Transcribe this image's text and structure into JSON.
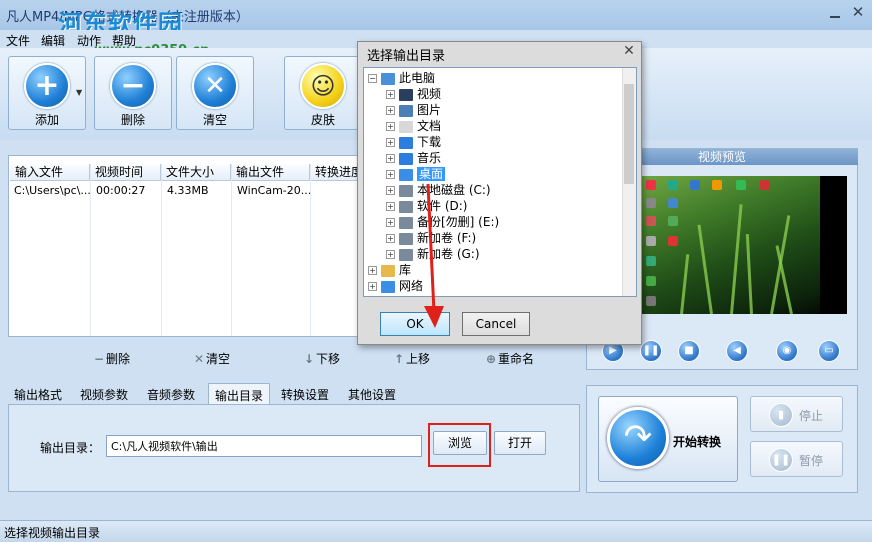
{
  "window": {
    "title": "凡人MP4/MPG格式转换器（未注册版本）",
    "watermark_name": "河东软件园",
    "watermark_url": "www.pc0359.cn"
  },
  "menu": [
    "文件",
    "编辑",
    "动作",
    "帮助"
  ],
  "toolbar": {
    "add": "添加",
    "delete": "删除",
    "clear": "清空",
    "skin": "皮肤"
  },
  "file_table": {
    "headers": [
      "输入文件",
      "视频时间",
      "文件大小",
      "输出文件",
      "转换进度"
    ],
    "rows": [
      [
        "C:\\Users\\pc\\...",
        "00:00:27",
        "4.33MB",
        "WinCam-20...",
        ""
      ]
    ]
  },
  "list_actions": {
    "delete": "删除",
    "clear": "清空",
    "move_down": "下移",
    "move_up": "上移",
    "rename": "重命名"
  },
  "tabs": [
    "输出格式",
    "视频参数",
    "音频参数",
    "输出目录",
    "转换设置",
    "其他设置"
  ],
  "active_tab": "输出目录",
  "output": {
    "label": "输出目录：",
    "path": "C:\\凡人视频软件\\输出",
    "browse": "浏览",
    "open": "打开"
  },
  "preview": {
    "title": "视频预览"
  },
  "convert": {
    "start": "开始转换",
    "stop": "停止",
    "pause": "暂停"
  },
  "status": "选择视频输出目录",
  "dialog": {
    "title": "选择输出目录",
    "tree": [
      {
        "label": "此电脑",
        "level": 0,
        "expander": "−",
        "icon_color": "#4a90d9"
      },
      {
        "label": "视频",
        "level": 1,
        "expander": "+",
        "icon_color": "#2a3f5f"
      },
      {
        "label": "图片",
        "level": 1,
        "expander": "+",
        "icon_color": "#4b7fb5"
      },
      {
        "label": "文档",
        "level": 1,
        "expander": "+",
        "icon_color": "#d8d8d8"
      },
      {
        "label": "下载",
        "level": 1,
        "expander": "+",
        "icon_color": "#2b7de0"
      },
      {
        "label": "音乐",
        "level": 1,
        "expander": "+",
        "icon_color": "#2b7de0"
      },
      {
        "label": "桌面",
        "level": 1,
        "expander": "+",
        "icon_color": "#3a8ee6",
        "selected": true
      },
      {
        "label": "本地磁盘 (C:)",
        "level": 1,
        "expander": "+",
        "icon_color": "#7a8a9a"
      },
      {
        "label": "软件 (D:)",
        "level": 1,
        "expander": "+",
        "icon_color": "#7a8a9a"
      },
      {
        "label": "备份[勿删] (E:)",
        "level": 1,
        "expander": "+",
        "icon_color": "#7a8a9a"
      },
      {
        "label": "新加卷 (F:)",
        "level": 1,
        "expander": "+",
        "icon_color": "#7a8a9a"
      },
      {
        "label": "新加卷 (G:)",
        "level": 1,
        "expander": "+",
        "icon_color": "#7a8a9a"
      },
      {
        "label": "库",
        "level": 0,
        "expander": "+",
        "icon_color": "#e7b84a"
      },
      {
        "label": "网络",
        "level": 0,
        "expander": "+",
        "icon_color": "#3a8ee6"
      }
    ],
    "ok": "OK",
    "cancel": "Cancel"
  }
}
